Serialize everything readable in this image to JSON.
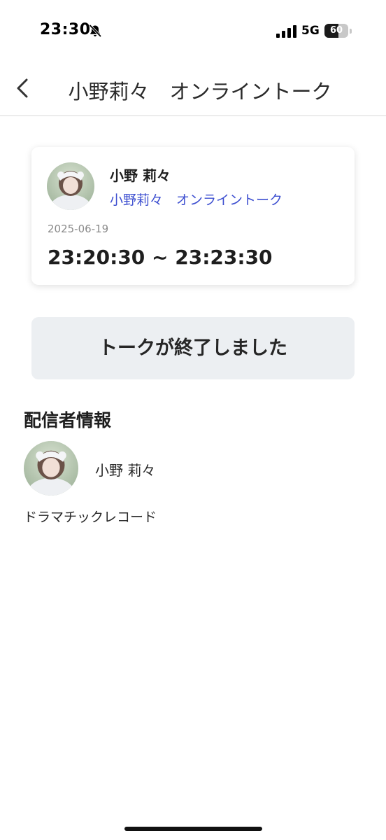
{
  "status_bar": {
    "time": "23:30",
    "network": "5G",
    "battery": "60",
    "battery_level_percent": 60,
    "icons": [
      "bell-slash-icon",
      "signal-icon",
      "battery-icon"
    ]
  },
  "header": {
    "back_icon": "chevron-left-icon",
    "title": "小野莉々　オンライントーク"
  },
  "event_card": {
    "name": "小野 莉々",
    "event_link": "小野莉々　オンライントーク",
    "date": "2025-06-19",
    "time_range": "23:20:30 ~ 23:23:30",
    "link_color": "#3d4fd0"
  },
  "talk_status": {
    "label": "トークが終了しました"
  },
  "distributor": {
    "section_title": "配信者情報",
    "name": "小野 莉々",
    "label": "ドラマチックレコード"
  }
}
